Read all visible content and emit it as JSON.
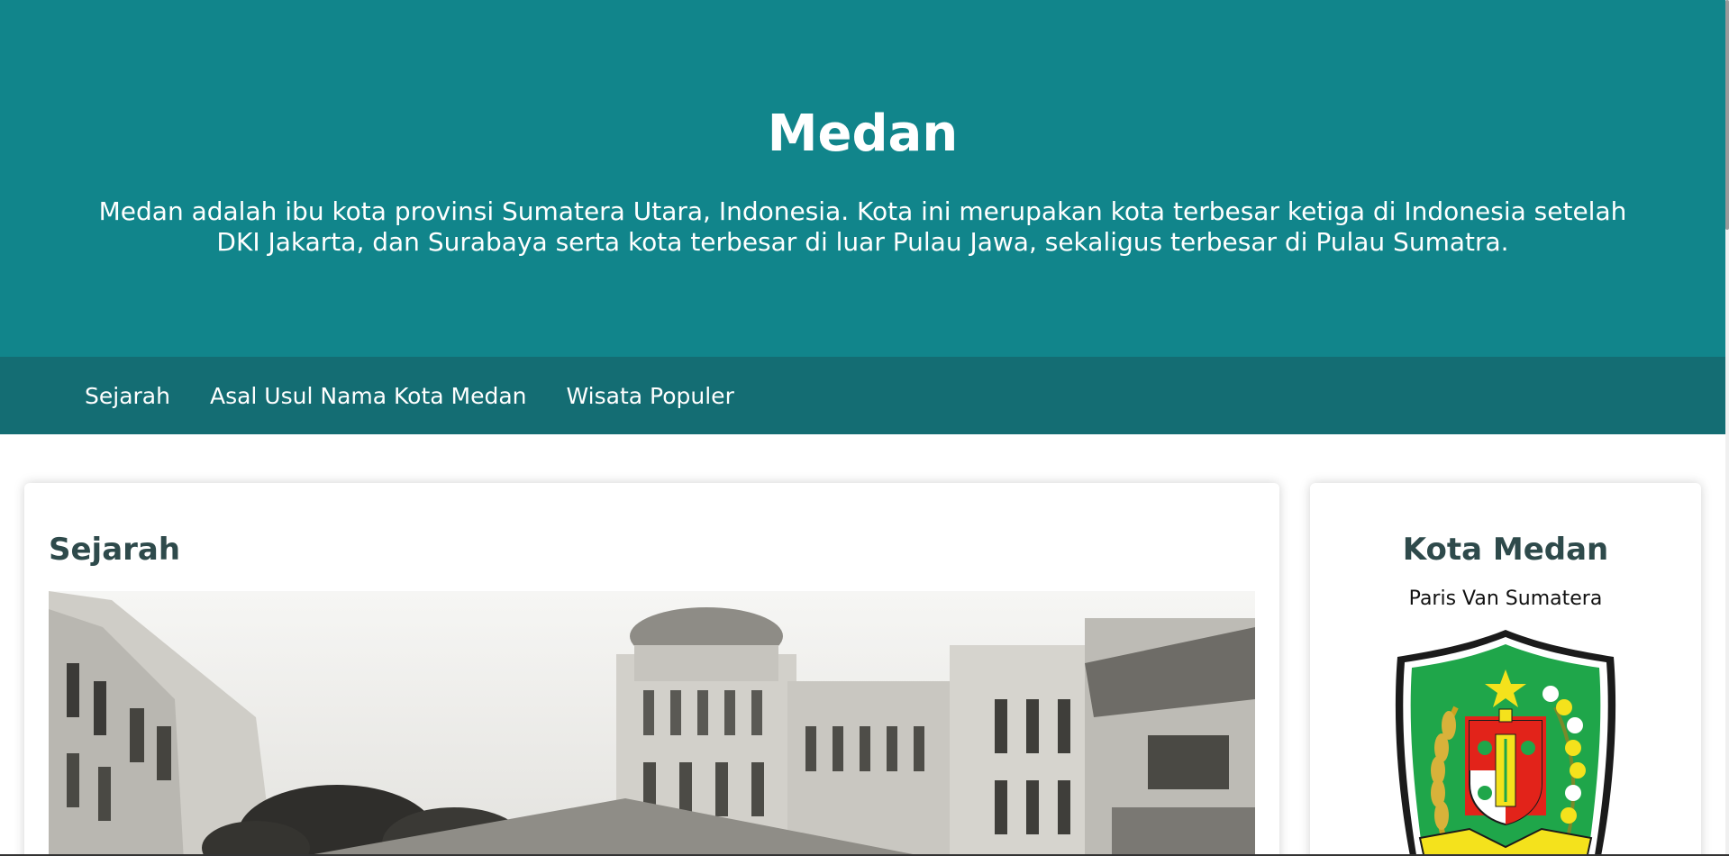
{
  "hero": {
    "title": "Medan",
    "description": "Medan adalah ibu kota provinsi Sumatera Utara, Indonesia. Kota ini merupakan kota terbesar ketiga di Indonesia setelah DKI Jakarta, dan Surabaya serta kota terbesar di luar Pulau Jawa, sekaligus terbesar di Pulau Sumatra."
  },
  "nav": {
    "items": [
      {
        "label": "Sejarah"
      },
      {
        "label": "Asal Usul Nama Kota Medan"
      },
      {
        "label": "Wisata Populer"
      }
    ]
  },
  "main": {
    "section_title": "Sejarah"
  },
  "sidebar": {
    "title": "Kota Medan",
    "tagline": "Paris Van Sumatera"
  },
  "colors": {
    "hero_bg": "#11858b",
    "nav_bg": "#146d73",
    "heading": "#2e4a4b"
  }
}
